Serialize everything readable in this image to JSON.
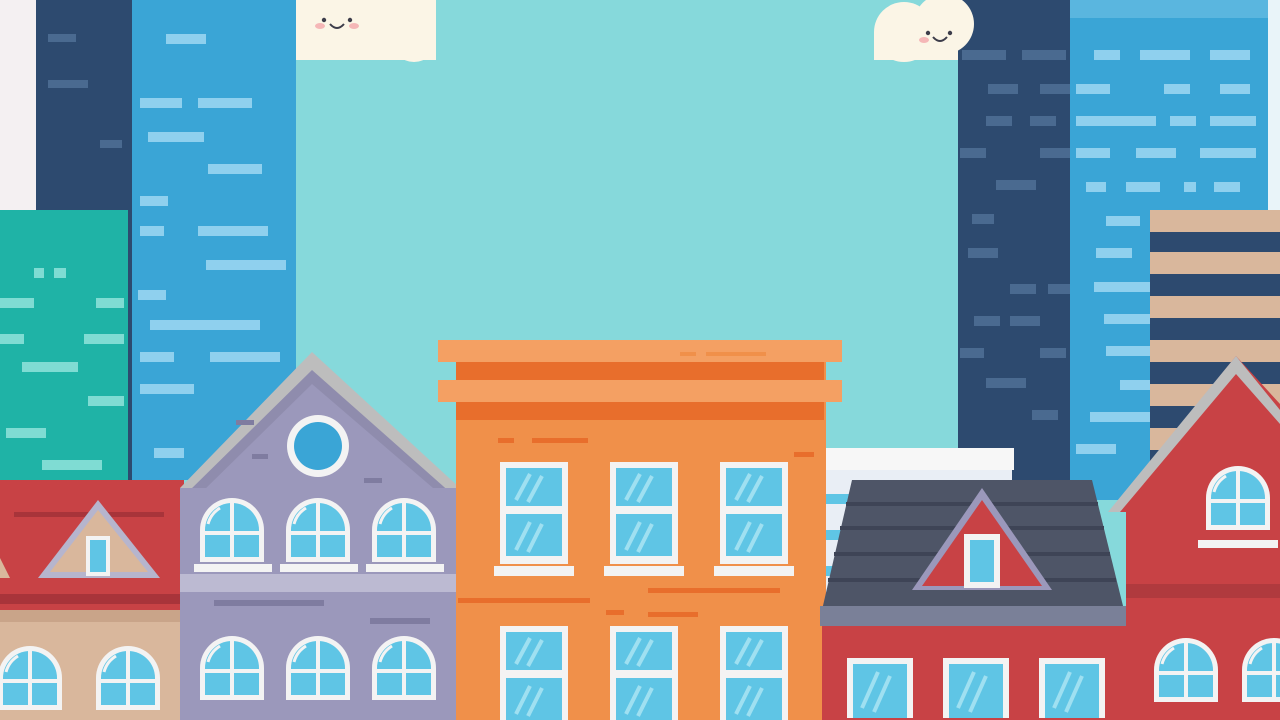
{
  "scene": {
    "title": "",
    "elements": [
      "sky",
      "cloud-left",
      "cloud-right",
      "skyscraper-navy-left",
      "skyscraper-blue-left",
      "skyscraper-teal-left",
      "skyscraper-navy-right",
      "skyscraper-blue-right",
      "skyscraper-tan-right",
      "house-red-left",
      "house-lavender",
      "building-orange",
      "house-slate-roof",
      "house-red-right"
    ]
  },
  "colors": {
    "sky": "#86d9db",
    "navy": "#2d4a6f",
    "tower_blue": "#3aa5d6",
    "teal": "#1fb3a6",
    "tan": "#d9b79c",
    "brick_red": "#c84245",
    "lavender": "#9b98bb",
    "orange": "#f0904a",
    "orange_dark": "#e86e2c",
    "slate": "#4e5567",
    "window_glass": "#5fc5e5",
    "window_frame": "#f3f3f3",
    "cloud": "#fbf5e6"
  }
}
